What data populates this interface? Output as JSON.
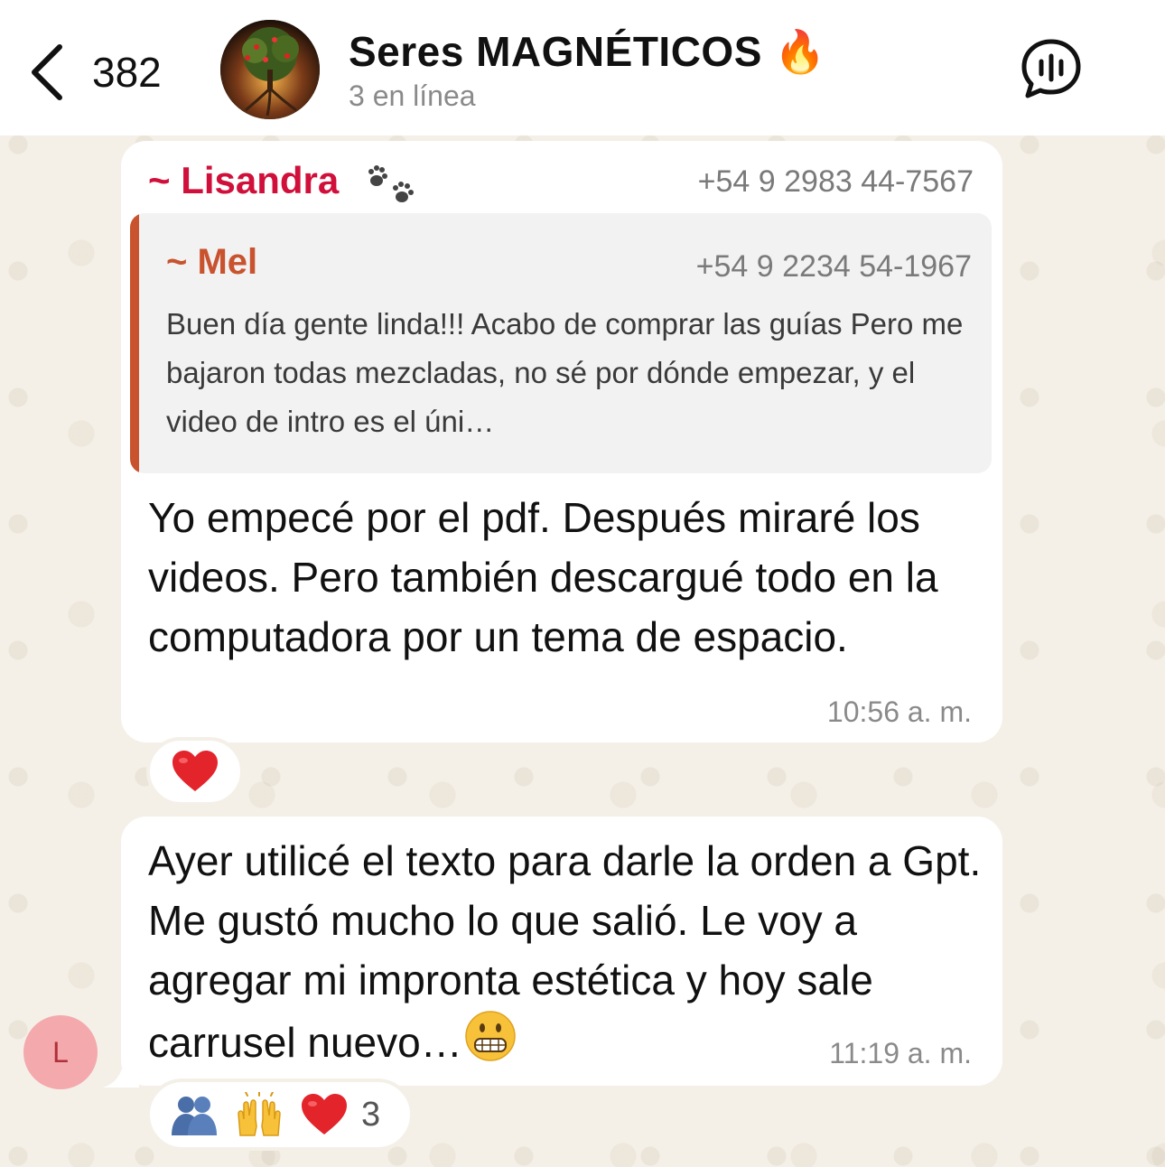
{
  "header": {
    "back_count": "382",
    "title": "Seres MAGNÉTICOS 🔥",
    "subtitle": "3 en línea"
  },
  "messages": [
    {
      "sender": "~ Lisandra",
      "sender_phone": "+54 9 2983 44-7567",
      "quote": {
        "name": "~ Mel",
        "phone": "+54 9 2234 54-1967",
        "text": "Buen día gente linda!!! Acabo de comprar las guías Pero me bajaron todas mezcladas, no sé por dónde empezar, y el video de intro es el úni…"
      },
      "text": "Yo empecé por el pdf. Después miraré los videos. Pero también descargué todo en la computadora por un tema de espacio.",
      "time": "10:56 a. m.",
      "reactions": [
        "❤️"
      ]
    },
    {
      "text": "Ayer utilicé el texto para darle la orden a Gpt. Me gustó mucho lo que salió. Le voy a agregar mi impronta estética y hoy sale carrusel nuevo…",
      "trailing_emoji": "grimacing-face",
      "time": "11:19 a. m.",
      "reactions": [
        "people-hugging",
        "raising-hands",
        "red-heart"
      ],
      "reaction_count": "3",
      "sender_avatar_initial": "L"
    }
  ],
  "colors": {
    "sender_name": "#d0103a",
    "quote_accent": "#c8532e",
    "avatar_bg": "#f4a9ad"
  }
}
